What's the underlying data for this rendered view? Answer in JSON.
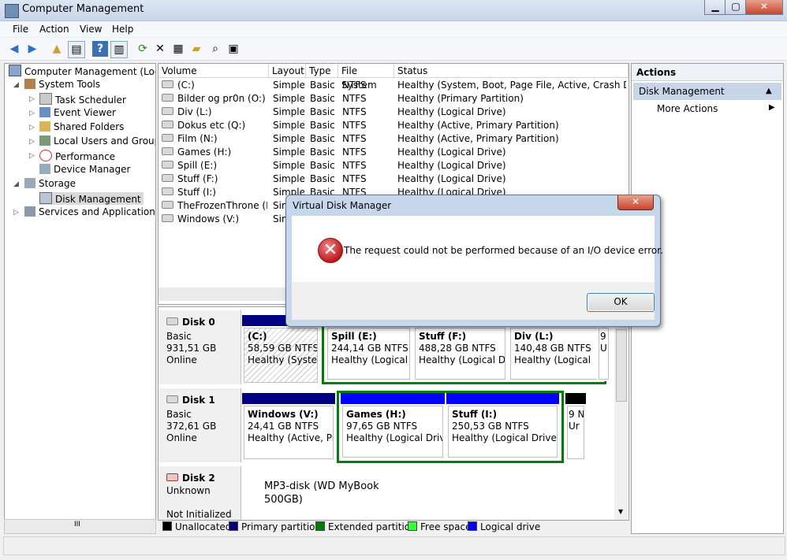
{
  "window": {
    "title": "Computer Management",
    "buttons": {
      "minimize": "▁",
      "maximize": "▢",
      "close": "✕"
    }
  },
  "menu": [
    "File",
    "Action",
    "View",
    "Help"
  ],
  "toolbar": [
    "back-icon",
    "forward-icon",
    "up-folder-icon",
    "show-hide-tree-icon",
    "help-icon",
    "show-hide-action-icon",
    "refresh-icon",
    "delete-icon",
    "properties-icon",
    "open-icon",
    "search-icon",
    "export-icon"
  ],
  "tree": {
    "root": "Computer Management (Local",
    "system_tools": "System Tools",
    "task_scheduler": "Task Scheduler",
    "event_viewer": "Event Viewer",
    "shared_folders": "Shared Folders",
    "local_users": "Local Users and Groups",
    "performance": "Performance",
    "device_manager": "Device Manager",
    "storage": "Storage",
    "disk_management": "Disk Management",
    "services": "Services and Applications",
    "scroll_glyph": "III"
  },
  "list": {
    "columns": [
      "Volume",
      "Layout",
      "Type",
      "File System",
      "Status"
    ],
    "rows": [
      {
        "volume": "(C:)",
        "layout": "Simple",
        "type": "Basic",
        "fs": "NTFS",
        "status": "Healthy (System, Boot, Page File, Active, Crash Dump, P"
      },
      {
        "volume": "Bilder og pr0n (O:)",
        "layout": "Simple",
        "type": "Basic",
        "fs": "NTFS",
        "status": "Healthy (Primary Partition)"
      },
      {
        "volume": "Div (L:)",
        "layout": "Simple",
        "type": "Basic",
        "fs": "NTFS",
        "status": "Healthy (Logical Drive)"
      },
      {
        "volume": "Dokus etc (Q:)",
        "layout": "Simple",
        "type": "Basic",
        "fs": "NTFS",
        "status": "Healthy (Active, Primary Partition)"
      },
      {
        "volume": "Film (N:)",
        "layout": "Simple",
        "type": "Basic",
        "fs": "NTFS",
        "status": "Healthy (Active, Primary Partition)"
      },
      {
        "volume": "Games (H:)",
        "layout": "Simple",
        "type": "Basic",
        "fs": "NTFS",
        "status": "Healthy (Logical Drive)"
      },
      {
        "volume": "Spill (E:)",
        "layout": "Simple",
        "type": "Basic",
        "fs": "NTFS",
        "status": "Healthy (Logical Drive)"
      },
      {
        "volume": "Stuff (F:)",
        "layout": "Simple",
        "type": "Basic",
        "fs": "NTFS",
        "status": "Healthy (Logical Drive)"
      },
      {
        "volume": "Stuff (I:)",
        "layout": "Simple",
        "type": "Basic",
        "fs": "NTFS",
        "status": "Healthy (Logical Drive)"
      },
      {
        "volume": "TheFrozenThrone (D:)",
        "layout": "Sim",
        "type": "",
        "fs": "",
        "status": ""
      },
      {
        "volume": "Windows (V:)",
        "layout": "Sim",
        "type": "",
        "fs": "",
        "status": ""
      }
    ]
  },
  "disks": {
    "disk0": {
      "name": "Disk 0",
      "type": "Basic",
      "size": "931,51 GB",
      "state": "Online"
    },
    "disk1": {
      "name": "Disk 1",
      "type": "Basic",
      "size": "372,61 GB",
      "state": "Online"
    },
    "disk2": {
      "name": "Disk 2",
      "type": "Unknown",
      "state": "Not Initialized",
      "desc_line1": "MP3-disk (WD MyBook",
      "desc_line2": "500GB)"
    }
  },
  "partitions": {
    "d0_c": {
      "name": "(C:)",
      "size": "58,59 GB NTFS",
      "status": "Healthy (System"
    },
    "d0_spill": {
      "name": "Spill  (E:)",
      "size": "244,14 GB NTFS",
      "status": "Healthy (Logical D"
    },
    "d0_stuff": {
      "name": "Stuff  (F:)",
      "size": "488,28 GB NTFS",
      "status": "Healthy (Logical Dri"
    },
    "d0_div": {
      "name": "Div  (L:)",
      "size": "140,48 GB NTFS",
      "status": "Healthy (Logical"
    },
    "d0_more": {
      "name": "9",
      "size": "U"
    },
    "d1_windows": {
      "name": "Windows  (V:)",
      "size": "24,41 GB NTFS",
      "status": "Healthy (Active, Prir"
    },
    "d1_games": {
      "name": "Games  (H:)",
      "size": "97,65 GB NTFS",
      "status": "Healthy (Logical Drive)"
    },
    "d1_stuff": {
      "name": "Stuff  (I:)",
      "size": "250,53 GB NTFS",
      "status": "Healthy (Logical Drive)"
    },
    "d1_more": {
      "name": "9 N",
      "size": "Ur"
    }
  },
  "legend": [
    {
      "label": "Unallocated",
      "color": "#000000"
    },
    {
      "label": "Primary partition",
      "color": "#000080"
    },
    {
      "label": "Extended partition",
      "color": "#008000"
    },
    {
      "label": "Free space",
      "color": "#33ff33"
    },
    {
      "label": "Logical drive",
      "color": "#0000ff"
    }
  ],
  "actions": {
    "header": "Actions",
    "section": "Disk Management",
    "more": "More Actions"
  },
  "dialog": {
    "title": "Virtual Disk Manager",
    "message": "The request could not be performed because of an I/O device error.",
    "ok": "OK",
    "close": "✕",
    "error_glyph": "✕"
  },
  "colors": {
    "primary": "#000080",
    "logical": "#0000ff",
    "extended": "#008000",
    "unallocated": "#000000"
  }
}
